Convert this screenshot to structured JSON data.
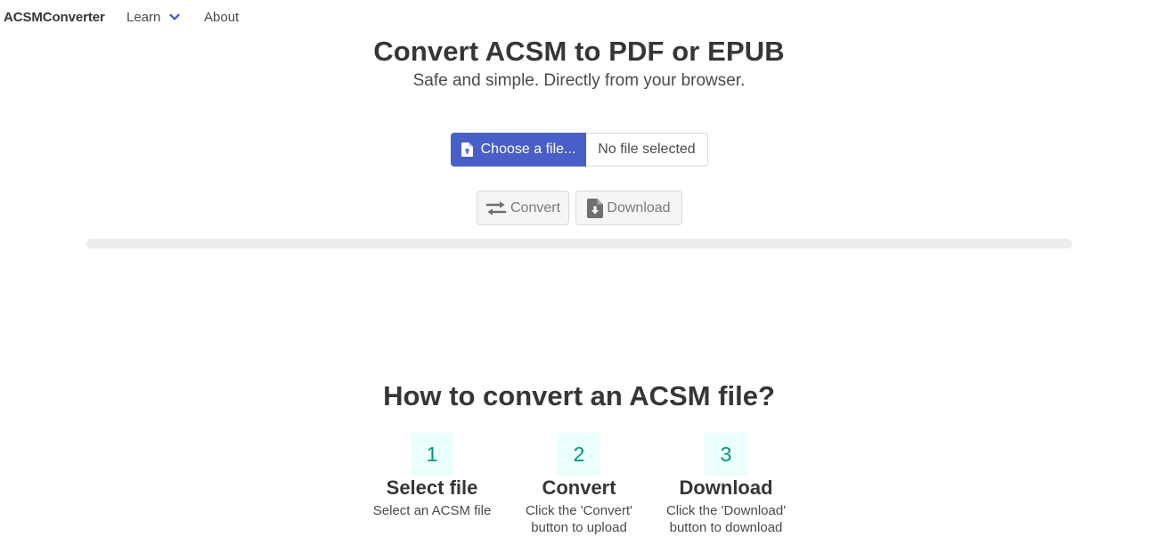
{
  "navbar": {
    "brand": "ACSMConverter",
    "learn_label": "Learn",
    "about_label": "About"
  },
  "hero": {
    "title": "Convert ACSM to PDF or EPUB",
    "subtitle": "Safe and simple. Directly from your browser."
  },
  "file_input": {
    "button_label": "Choose a file...",
    "file_name": "No file selected",
    "icon": "file-upload-icon"
  },
  "actions": {
    "convert_label": "Convert",
    "convert_icon": "exchange-icon",
    "download_label": "Download",
    "download_icon": "file-download-icon",
    "disabled": true
  },
  "progress": {
    "value": 0
  },
  "howto": {
    "title": "How to convert an ACSM file?",
    "steps": [
      {
        "number": "1",
        "title": "Select file",
        "desc_lines": [
          "Select an ACSM file"
        ]
      },
      {
        "number": "2",
        "title": "Convert",
        "desc_lines": [
          "Click the 'Convert'",
          "button to upload"
        ]
      },
      {
        "number": "3",
        "title": "Download",
        "desc_lines": [
          "Click the 'Download'",
          "button to download"
        ]
      }
    ]
  },
  "colors": {
    "primary": "#485fc7",
    "step_bg": "#ebfffc",
    "step_text": "#00947e",
    "progress_track": "#ededed"
  }
}
